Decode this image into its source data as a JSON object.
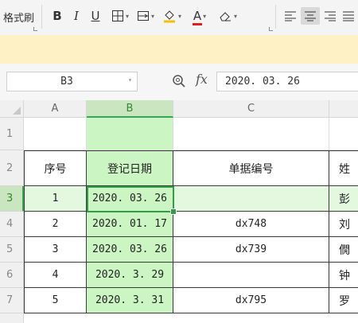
{
  "ribbon": {
    "format_painter_label": "格式刷",
    "bold": "B",
    "italic": "I",
    "underline": "U",
    "font_color_letter": "A",
    "font_color_accent": "#e02020",
    "fill_color_accent": "#f2c200"
  },
  "name_box": {
    "value": "B3"
  },
  "formula_bar": {
    "fx_label": "fx",
    "value": "2020. 03. 26"
  },
  "columns": [
    "A",
    "B",
    "C"
  ],
  "rows": [
    "1",
    "2",
    "3",
    "4",
    "5",
    "6",
    "7"
  ],
  "headers": {
    "seq": "序号",
    "date": "登记日期",
    "doc_no": "单据编号",
    "name_partial": "姓"
  },
  "data_rows": [
    {
      "seq": "1",
      "date": "2020. 03. 26",
      "doc_no": "",
      "name": "彭"
    },
    {
      "seq": "2",
      "date": "2020. 01. 17",
      "doc_no": "dx748",
      "name": "刘"
    },
    {
      "seq": "3",
      "date": "2020. 03. 26",
      "doc_no": "dx739",
      "name": "僩"
    },
    {
      "seq": "4",
      "date": "2020. 3. 29",
      "doc_no": "",
      "name": "钟"
    },
    {
      "seq": "5",
      "date": "2020. 3. 31",
      "doc_no": "dx795",
      "name": "罗"
    }
  ],
  "colors": {
    "selection": "#2f9e44",
    "column_b_fill": "#ccf5c4",
    "notice_band": "#fdf1c5"
  }
}
